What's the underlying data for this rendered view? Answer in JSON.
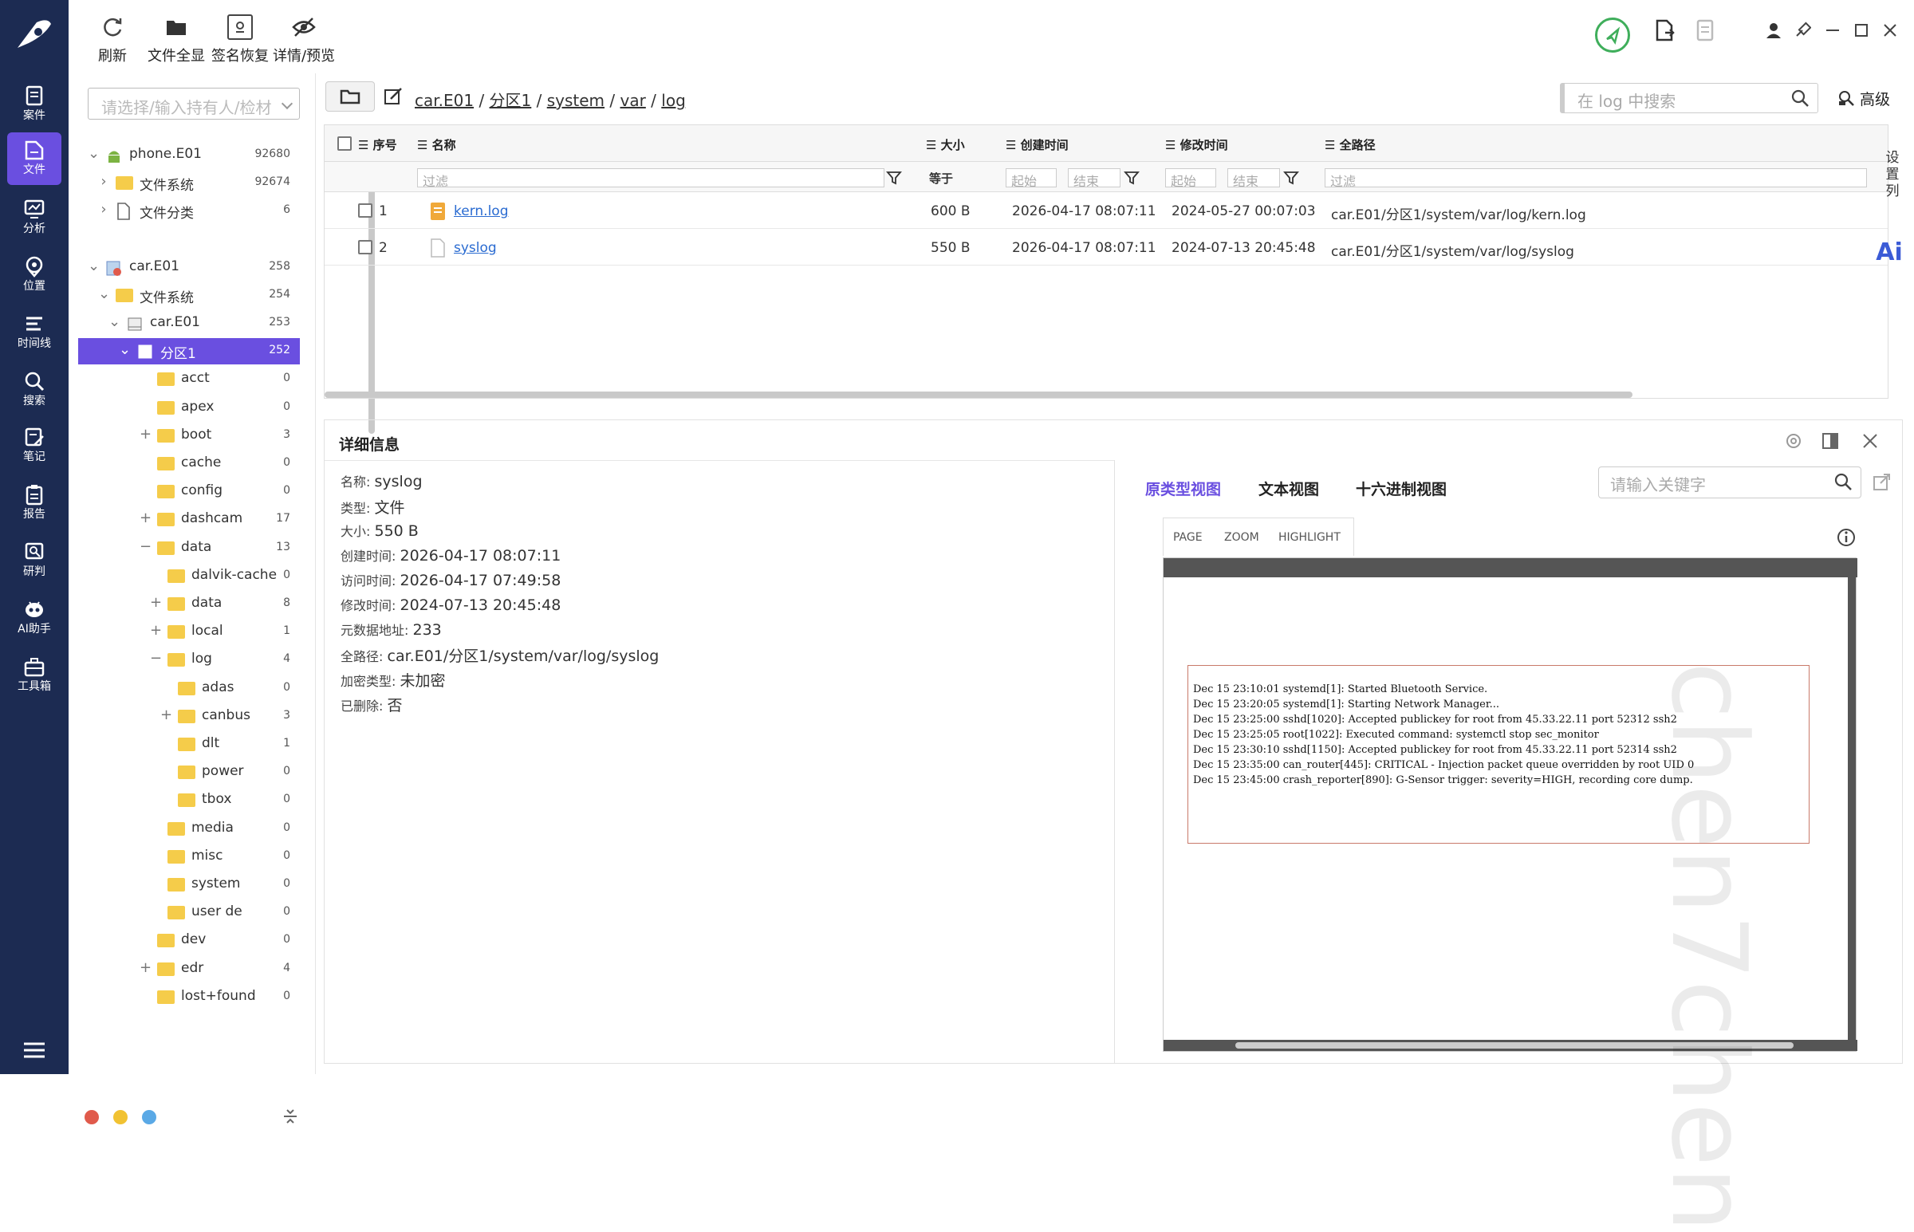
{
  "nav": [
    {
      "label": "案件",
      "icon": "case-icon"
    },
    {
      "label": "文件",
      "icon": "file-icon",
      "active": true
    },
    {
      "label": "分析",
      "icon": "analysis-icon"
    },
    {
      "label": "位置",
      "icon": "location-icon"
    },
    {
      "label": "时间线",
      "icon": "timeline-icon"
    },
    {
      "label": "搜索",
      "icon": "search-icon"
    },
    {
      "label": "笔记",
      "icon": "note-icon"
    },
    {
      "label": "报告",
      "icon": "report-icon"
    },
    {
      "label": "研判",
      "icon": "judge-icon"
    },
    {
      "label": "AI助手",
      "icon": "ai-assistant-icon"
    },
    {
      "label": "工具箱",
      "icon": "toolbox-icon"
    }
  ],
  "toolbar": {
    "refresh": "刷新",
    "all_files": "文件全显",
    "sig_recover": "签名恢复",
    "detail_preview": "详情/预览"
  },
  "tree": {
    "holder_placeholder": "请选择/输入持有人/检材",
    "items": [
      {
        "label": "phone.E01",
        "count": "92680"
      },
      {
        "label": "文件系统",
        "count": "92674"
      },
      {
        "label": "文件分类",
        "count": "6"
      },
      {
        "label": "car.E01",
        "count": "258"
      },
      {
        "label": "文件系统",
        "count": "254"
      },
      {
        "label": "car.E01",
        "count": "253"
      },
      {
        "label": "分区1",
        "count": "252"
      },
      {
        "label": "acct",
        "count": "0"
      },
      {
        "label": "apex",
        "count": "0"
      },
      {
        "label": "boot",
        "count": "3"
      },
      {
        "label": "cache",
        "count": "0"
      },
      {
        "label": "config",
        "count": "0"
      },
      {
        "label": "dashcam",
        "count": "17"
      },
      {
        "label": "data",
        "count": "13"
      },
      {
        "label": "dalvik-cache",
        "count": "0"
      },
      {
        "label": "data",
        "count": "8"
      },
      {
        "label": "local",
        "count": "1"
      },
      {
        "label": "log",
        "count": "4"
      },
      {
        "label": "adas",
        "count": "0"
      },
      {
        "label": "canbus",
        "count": "3"
      },
      {
        "label": "dlt",
        "count": "1"
      },
      {
        "label": "power",
        "count": "0"
      },
      {
        "label": "tbox",
        "count": "0"
      },
      {
        "label": "media",
        "count": "0"
      },
      {
        "label": "misc",
        "count": "0"
      },
      {
        "label": "system",
        "count": "0"
      },
      {
        "label": "user de",
        "count": "0"
      },
      {
        "label": "dev",
        "count": "0"
      },
      {
        "label": "edr",
        "count": "4"
      },
      {
        "label": "lost+found",
        "count": "0"
      }
    ]
  },
  "path": {
    "crumbs": [
      "car.E01",
      "分区1",
      "system",
      "var",
      "log"
    ],
    "search_placeholder": "在 log 中搜索",
    "advanced": "高级"
  },
  "grid": {
    "headers": [
      "序号",
      "名称",
      "大小",
      "创建时间",
      "修改时间",
      "全路径"
    ],
    "filters": {
      "filter": "过滤",
      "equals": "等于",
      "start": "起始",
      "end": "结束"
    },
    "rows": [
      {
        "no": "1",
        "name": "kern.log",
        "size": "600 B",
        "created": "2026-04-17 08:07:11",
        "modified": "2024-05-27 00:07:03",
        "path": "car.E01/分区1/system/var/log/kern.log"
      },
      {
        "no": "2",
        "name": "syslog",
        "size": "550 B",
        "created": "2026-04-17 08:07:11",
        "modified": "2024-07-13 20:45:48",
        "path": "car.E01/分区1/system/var/log/syslog"
      }
    ],
    "side_tab": "设置列",
    "ai_badge": "Ai"
  },
  "details": {
    "title": "详细信息",
    "fields": [
      {
        "k": "名称:",
        "v": "syslog"
      },
      {
        "k": "类型:",
        "v": "文件"
      },
      {
        "k": "大小:",
        "v": "550 B"
      },
      {
        "k": "创建时间:",
        "v": "2026-04-17 08:07:11"
      },
      {
        "k": "访问时间:",
        "v": "2026-04-17 07:49:58"
      },
      {
        "k": "修改时间:",
        "v": "2024-07-13 20:45:48"
      },
      {
        "k": "元数据地址:",
        "v": "233"
      },
      {
        "k": "全路径:",
        "v": "car.E01/分区1/system/var/log/syslog"
      },
      {
        "k": "加密类型:",
        "v": "未加密"
      },
      {
        "k": "已删除:",
        "v": "否"
      }
    ]
  },
  "preview": {
    "tabs": [
      "原类型视图",
      "文本视图",
      "十六进制视图"
    ],
    "keyword_placeholder": "请输入关键字",
    "pv_toolbar": [
      "PAGE",
      "ZOOM",
      "HIGHLIGHT"
    ],
    "log_lines": [
      "Dec 15 23:10:01 systemd[1]: Started Bluetooth Service.",
      "Dec 15 23:20:05 systemd[1]: Starting Network Manager...",
      "Dec 15 23:25:00 sshd[1020]: Accepted publickey for root from 45.33.22.11 port 52312 ssh2",
      "Dec 15 23:25:05 root[1022]: Executed command: systemctl stop sec_monitor",
      "Dec 15 23:30:10 sshd[1150]: Accepted publickey for root from 45.33.22.11 port 52314 ssh2",
      "Dec 15 23:35:00 can_router[445]: CRITICAL - Injection packet queue overridden by root UID 0",
      "Dec 15 23:45:00 crash_reporter[890]: G-Sensor trigger: severity=HIGH, recording core dump."
    ],
    "watermark": "chen7chen"
  },
  "colors": {
    "accent": "#6a4fe0",
    "nav_bg": "#1c2b52",
    "link": "#2a6bd1",
    "folder": "#f5cc4a"
  }
}
